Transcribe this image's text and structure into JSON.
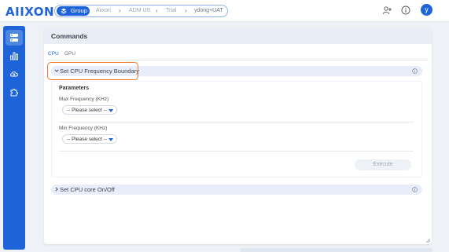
{
  "app": {
    "logo": "aiixon",
    "avatar_initial": "y"
  },
  "breadcrumb": {
    "group_label": "Group",
    "items": [
      "Aiixon",
      "ADM US",
      "Trial",
      "ydong+UAT"
    ]
  },
  "sidebar": {
    "items": [
      {
        "icon": "server-icon",
        "active": true
      },
      {
        "icon": "bar-chart-icon",
        "active": false
      },
      {
        "icon": "cloud-upload-icon",
        "active": false
      },
      {
        "icon": "puzzle-icon",
        "active": false
      }
    ]
  },
  "commands": {
    "title": "Commands",
    "tabs": [
      {
        "label": "CPU",
        "active": true
      },
      {
        "label": "GPU",
        "active": false
      }
    ],
    "sections": [
      {
        "label": "Set CPU Frequency Boundary",
        "expanded": true,
        "params_title": "Parameters",
        "fields": [
          {
            "label": "Max Frequency (KHz)",
            "value": "-- Please select --"
          },
          {
            "label": "Min Frequency (KHz)",
            "value": "-- Please select --"
          }
        ],
        "execute_label": "Execute"
      },
      {
        "label": "Set CPU core On/Off",
        "expanded": false
      }
    ]
  },
  "colors": {
    "brand": "#1e64d8",
    "highlight": "#ec7a2c",
    "panel_head": "#e9edf5"
  }
}
